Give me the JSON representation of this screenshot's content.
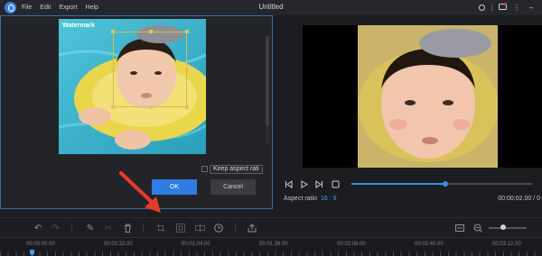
{
  "app": {
    "title": "Untitled"
  },
  "menu": [
    "File",
    "Edit",
    "Export",
    "Help"
  ],
  "window_controls": [
    "user-icon",
    "messages-icon",
    "more-icon",
    "minimize-icon"
  ],
  "crop_dialog": {
    "watermark_text": "Watermark",
    "keep_aspect_label": "Keep aspect rati",
    "ok_label": "OK",
    "cancel_label": "Cancel",
    "keep_aspect_checked": false
  },
  "preview": {
    "aspect_ratio_label": "Aspect ratio",
    "aspect_ratio_value": "16 : 9",
    "time": "00:00:02.00 / 0",
    "progress_fraction": 0.52
  },
  "toolbar": {
    "tools": [
      "undo-icon",
      "redo-icon",
      "pencil-icon",
      "scissors-icon",
      "trash-icon",
      "crop-icon",
      "freeze-frame-icon",
      "split-icon",
      "duration-icon",
      "export-share-icon"
    ]
  },
  "timeline": {
    "ticks": [
      "00:00:00.00",
      "00:00:32.00",
      "00:01:04.00",
      "00:01:36.00",
      "00:02:08.00",
      "00:02:40.00",
      "00:03:12.00"
    ]
  },
  "colors": {
    "accent": "#2f7ce3",
    "annotation_arrow": "#e8392c"
  }
}
